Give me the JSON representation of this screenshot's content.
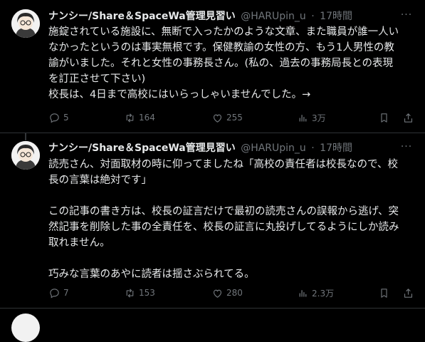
{
  "tweets": [
    {
      "author_name": "ナンシー/Share＆SpaceWa管理見習い",
      "handle": "@HARUpin_u",
      "separator": "·",
      "time": "17時間",
      "text": "施錠されている施設に、無断で入ったかのような文章、また職員が誰一人い\nなかったというのは事実無根です。保健教諭の女性の方、もう1人男性の教\n諭がいました。それと女性の事務長さん。(私の、過去の事務局長との表現\nを訂正させて下さい)\n校長は、4日まで高校にはいらっしゃいませんでした。→",
      "replies": "5",
      "retweets": "164",
      "likes": "255",
      "views": "3万"
    },
    {
      "author_name": "ナンシー/Share＆SpaceWa管理見習い",
      "handle": "@HARUpin_u",
      "separator": "·",
      "time": "17時間",
      "text": "読売さん、対面取材の時に仰ってましたね「高校の責任者は校長なので、校\n長の言葉は絶対です」\n\nこの記事の書き方は、校長の証言だけで最初の読売さんの誤報から逃げ、突\n然記事を削除した事の全責任を、校長の証言に丸投げしてるようにしか読み\n取れません。\n\n巧みな言葉のあやに読者は揺さぶられてる。",
      "replies": "7",
      "retweets": "153",
      "likes": "280",
      "views": "2.3万"
    }
  ],
  "more_symbol": "···",
  "colors": {
    "background": "#000000",
    "text_primary": "#e7e9ea",
    "text_secondary": "#71767b",
    "divider": "#2f3336"
  },
  "icons": [
    "reply-icon",
    "retweet-icon",
    "like-icon",
    "views-icon",
    "bookmark-icon",
    "share-icon",
    "more-icon"
  ]
}
